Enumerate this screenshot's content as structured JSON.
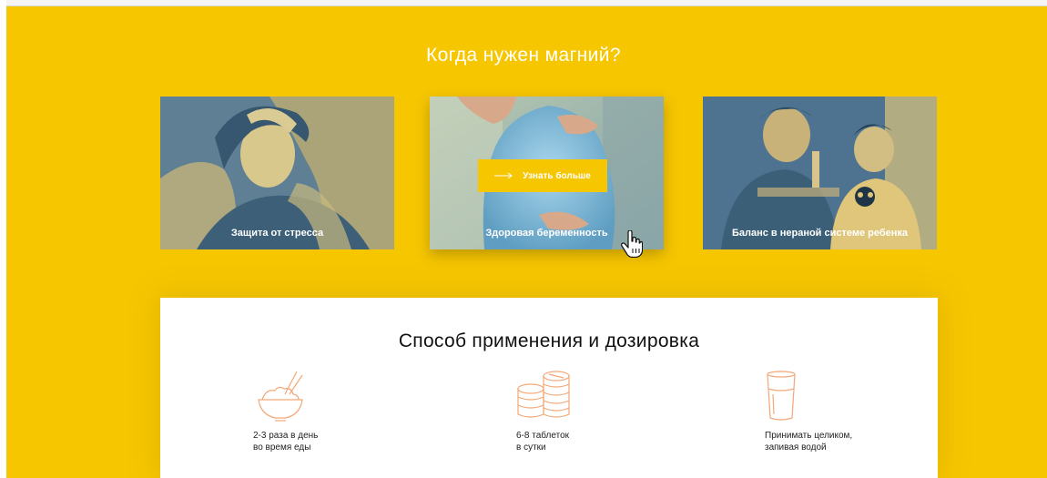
{
  "hero": {
    "title": "Когда нужен магний?"
  },
  "cards": [
    {
      "label": "Защита от стресса"
    },
    {
      "label": "Здоровая беременность",
      "button_label": "Узнать больше"
    },
    {
      "label": "Баланс в нераной системе ребенка"
    }
  ],
  "dosage": {
    "title": "Способ применения и дозировка",
    "items": [
      {
        "icon": "rice-bowl-icon",
        "text": "2-3 раза в день\nво время еды"
      },
      {
        "icon": "pill-stack-icon",
        "text": "6-8 таблеток\nв сутки"
      },
      {
        "icon": "water-glass-icon",
        "text": "Принимать целиком,\nзапивая водой"
      }
    ]
  },
  "colors": {
    "background_yellow": "#f6c600",
    "duotone_blue": "#4a6f8d",
    "icon_orange": "#f2a878"
  }
}
